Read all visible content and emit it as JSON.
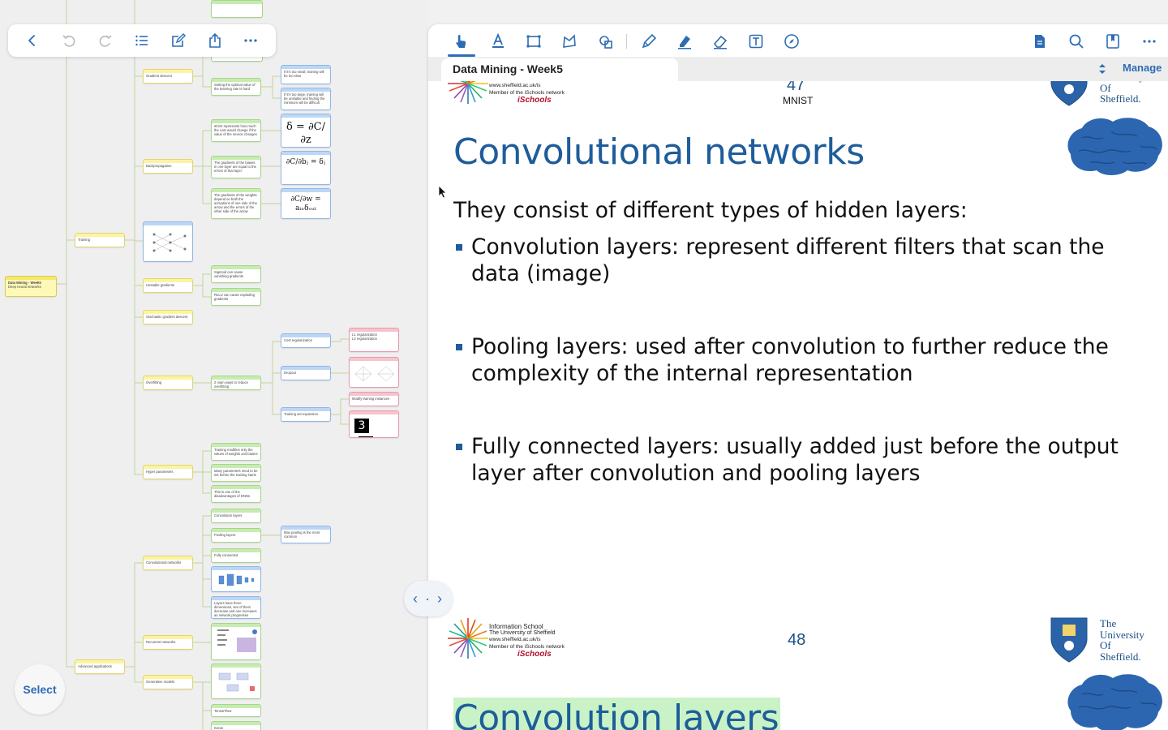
{
  "app": {
    "colors": {
      "accent": "#2d6cb5",
      "slide_title": "#1e5d9a",
      "highlight": "#c9f3c6",
      "mindmap_line": "#c6d39a"
    }
  },
  "left_toolbar": {
    "buttons": [
      "back-icon",
      "undo-icon",
      "redo-icon",
      "outline-list-icon",
      "edit-icon",
      "share-icon",
      "more-icon"
    ]
  },
  "mindmap": {
    "root": {
      "title": "Data Mining - Week5",
      "subtitle": "Deep neural networks"
    },
    "nodes": {
      "training": "Training",
      "gradient_descent": "Gradient descent",
      "backpropagation": "Backpropagation",
      "unstable_gradients": "Unstable gradients",
      "stochastic_gd": "Stochastic gradient descent",
      "overfitting": "Overfitting",
      "hyper_parameters": "Hyper parameters",
      "advanced_applications": "Advanced applications",
      "convolutional_networks": "Convolutional networks",
      "recurrent_networks": "Recurrent networks",
      "generative_models": "Generative models",
      "lr_optimal": "Setting the optimal value of the learning rate is hard",
      "lr_small": "If it's too small, training will be too slow",
      "lr_large": "If it's too large, training will be unstable and finding the minimum will be difficult",
      "delta_desc": "∂C/∂z represents how much the cost would change if the value of the neuron changes",
      "bias_desc": "The gradients of the biases in one layer are equal to the errors of that layer",
      "weight_desc": "The gradients of the weights depend on both the activations of one side of the arrow and the errors of the other side of the arrow",
      "sigmoid_vanish": "Sigmoid can cause vanishing gradients",
      "relu_explode": "ReLU can cause exploding gradients",
      "two_ways": "2 main ways to reduce overfitting",
      "cost_reg": "Cost regularization",
      "dropout": "Dropout",
      "training_set_expansion": "Training set expansion",
      "modify_instances": "Modify training instances",
      "l1_reg": "L1 regularization",
      "l2_reg": "L2 regularization",
      "hp_1": "Training modifies only the values of weights and biases",
      "hp_2": "Many parameters need to be set before the training starts",
      "hp_3": "This is one of the disadvantages of DNNs",
      "conv_layers": "Convolution layers",
      "pool_layers": "Pooling layers",
      "fully_connected": "Fully connected",
      "max_pooling": "Max pooling is the most common",
      "layers_dims": "Layers have three dimensions, two of them decrease and one increases as network progresses",
      "tensorflow": "TensorFlow",
      "keras": "Keras"
    },
    "math": {
      "delta": "δ = ∂C/∂z",
      "bias": "∂C/∂bⱼ = δⱼ",
      "weight": "∂C/∂w = aᵢₙδₒᵤₜ"
    },
    "digits": [
      "3",
      "3"
    ]
  },
  "select_button": {
    "label": "Select"
  },
  "pdf_toolbar": {
    "tools": [
      "pointer-tool-icon",
      "text-select-icon",
      "rectangle-select-icon",
      "lasso-icon",
      "shapes-icon",
      "pen-icon",
      "highlighter-icon",
      "eraser-icon",
      "text-box-icon",
      "compass-icon"
    ],
    "right_tools": [
      "document-icon",
      "search-icon",
      "bookmark-icon",
      "more-icon"
    ],
    "active_tool": "pointer-tool-icon"
  },
  "tab": {
    "title": "Data Mining - Week5",
    "manage_label": "Manage"
  },
  "pdf": {
    "page47": {
      "number": "47",
      "caption": "MNIST"
    },
    "slide47": {
      "title": "Convolutional networks",
      "intro": "They consist of different types of hidden layers:",
      "bullets": [
        {
          "line1": "Convolution layers: represent different filters that scan the",
          "line2": "data (image)"
        },
        {
          "line1": "Pooling layers: used after convolution to further reduce the",
          "line2": "complexity of the internal representation"
        },
        {
          "line1": "Fully connected layers: usually added just before the output",
          "line2": "layer after convolution and pooling layers"
        }
      ]
    },
    "page48": {
      "number": "48"
    },
    "slide48": {
      "title": "Convolution layers"
    },
    "footer": {
      "school_line1": "Information School",
      "school_line2": "The University of Sheffield",
      "school_line3": "www.sheffield.ac.uk/is",
      "school_line4": "Member of the iSchools network",
      "ischools": "iSchools",
      "uni_lines": [
        "The",
        "University",
        "Of",
        "Sheffield."
      ]
    }
  },
  "split_handle": {
    "label": "‹ · ›"
  }
}
